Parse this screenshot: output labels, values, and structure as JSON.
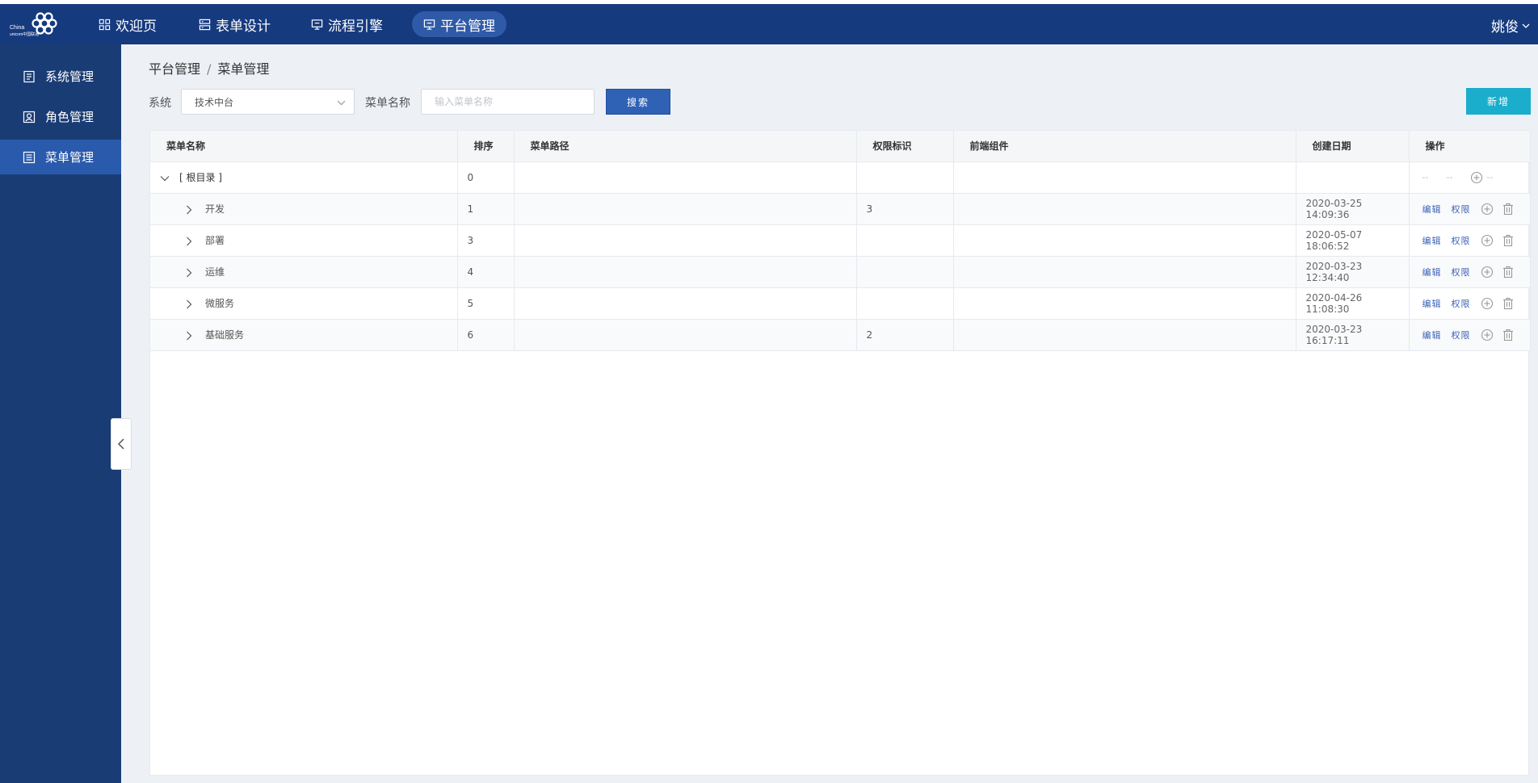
{
  "logo": {
    "line1": "China",
    "line2": "unicom中国联通"
  },
  "nav": [
    {
      "label": "欢迎页",
      "icon": "grid-icon"
    },
    {
      "label": "表单设计",
      "icon": "form-icon"
    },
    {
      "label": "流程引擎",
      "icon": "monitor-icon"
    },
    {
      "label": "平台管理",
      "icon": "monitor-icon",
      "active": true
    }
  ],
  "user": {
    "name": "姚俊"
  },
  "sidebar": {
    "items": [
      {
        "label": "系统管理",
        "icon": "system-icon"
      },
      {
        "label": "角色管理",
        "icon": "role-icon"
      },
      {
        "label": "菜单管理",
        "icon": "menu-list-icon",
        "active": true
      }
    ]
  },
  "breadcrumb": {
    "parent": "平台管理",
    "separator": "/",
    "current": "菜单管理"
  },
  "filters": {
    "system_label": "系统",
    "system_value": "技术中台",
    "menu_name_label": "菜单名称",
    "menu_name_placeholder": "输入菜单名称",
    "search_button": "搜索",
    "add_button": "新增"
  },
  "table": {
    "headers": [
      "菜单名称",
      "排序",
      "菜单路径",
      "权限标识",
      "前端组件",
      "创建日期",
      "操作"
    ],
    "root": {
      "name": "[ 根目录 ]",
      "order": "0",
      "ops": [
        "--",
        "--",
        "--"
      ]
    },
    "rows": [
      {
        "name": "开发",
        "order": "1",
        "path": "",
        "perm": "3",
        "component": "",
        "date": "2020-03-25 14:09:36"
      },
      {
        "name": "部署",
        "order": "3",
        "path": "",
        "perm": "",
        "component": "",
        "date": "2020-05-07 18:06:52"
      },
      {
        "name": "运维",
        "order": "4",
        "path": "",
        "perm": "",
        "component": "",
        "date": "2020-03-23 12:34:40"
      },
      {
        "name": "微服务",
        "order": "5",
        "path": "",
        "perm": "",
        "component": "",
        "date": "2020-04-26 11:08:30"
      },
      {
        "name": "基础服务",
        "order": "6",
        "path": "",
        "perm": "2",
        "component": "",
        "date": "2020-03-23 16:17:11"
      }
    ],
    "op_edit": "编辑",
    "op_perm": "权限"
  },
  "colors": {
    "topbar": "#163a7e",
    "sidebar": "#1a3c74",
    "sidebar_active": "#2a5aab",
    "search_btn": "#2f61b5",
    "add_btn": "#1aaecc",
    "link": "#3c63b6"
  }
}
